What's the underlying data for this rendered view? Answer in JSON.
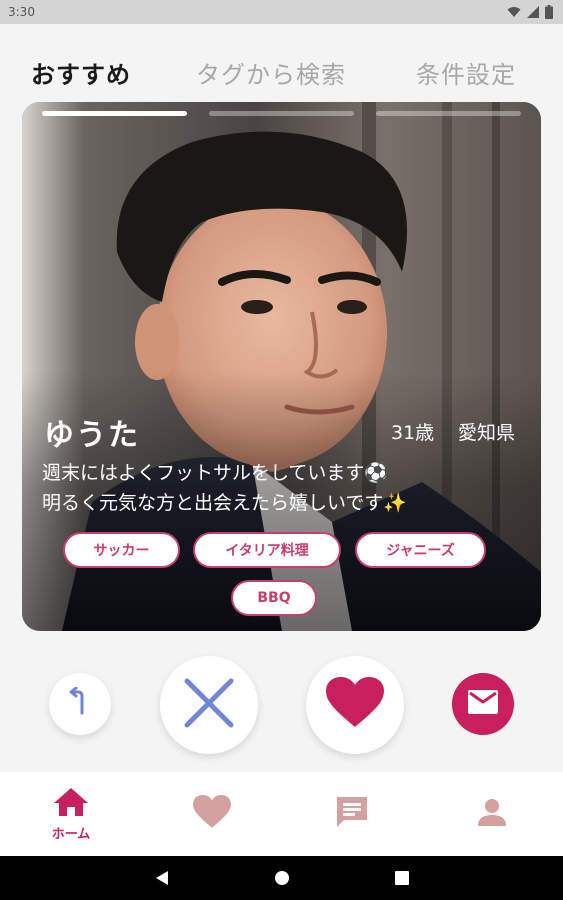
{
  "status_bar": {
    "time": "3:30",
    "icons": [
      "wifi-icon",
      "signal-icon",
      "battery-icon"
    ]
  },
  "tabs": [
    {
      "label": "おすすめ",
      "active": true
    },
    {
      "label": "タグから検索",
      "active": false
    },
    {
      "label": "条件設定",
      "active": false
    }
  ],
  "card": {
    "photo_count": 3,
    "current_photo": 1,
    "name": "ゆうた",
    "age": "31歳",
    "prefecture": "愛知県",
    "bio_line1": "週末にはよくフットサルをしています⚽",
    "bio_line2": "明るく元気な方と出会えたら嬉しいです✨",
    "tags": [
      "サッカー",
      "イタリア料理",
      "ジャニーズ",
      "BBQ"
    ]
  },
  "actions": [
    {
      "icon": "undo-icon"
    },
    {
      "icon": "close-icon"
    },
    {
      "icon": "heart-icon"
    },
    {
      "icon": "mail-icon"
    }
  ],
  "bottom_nav": {
    "home_label": "ホーム",
    "items": [
      "home-icon",
      "heart-icon",
      "chat-icon",
      "person-icon"
    ]
  },
  "colors": {
    "accent": "#c81f5f",
    "tag_border": "#c73d6e",
    "nope_blue": "#6f86d6",
    "inactive_nav": "#d4a0a0"
  }
}
